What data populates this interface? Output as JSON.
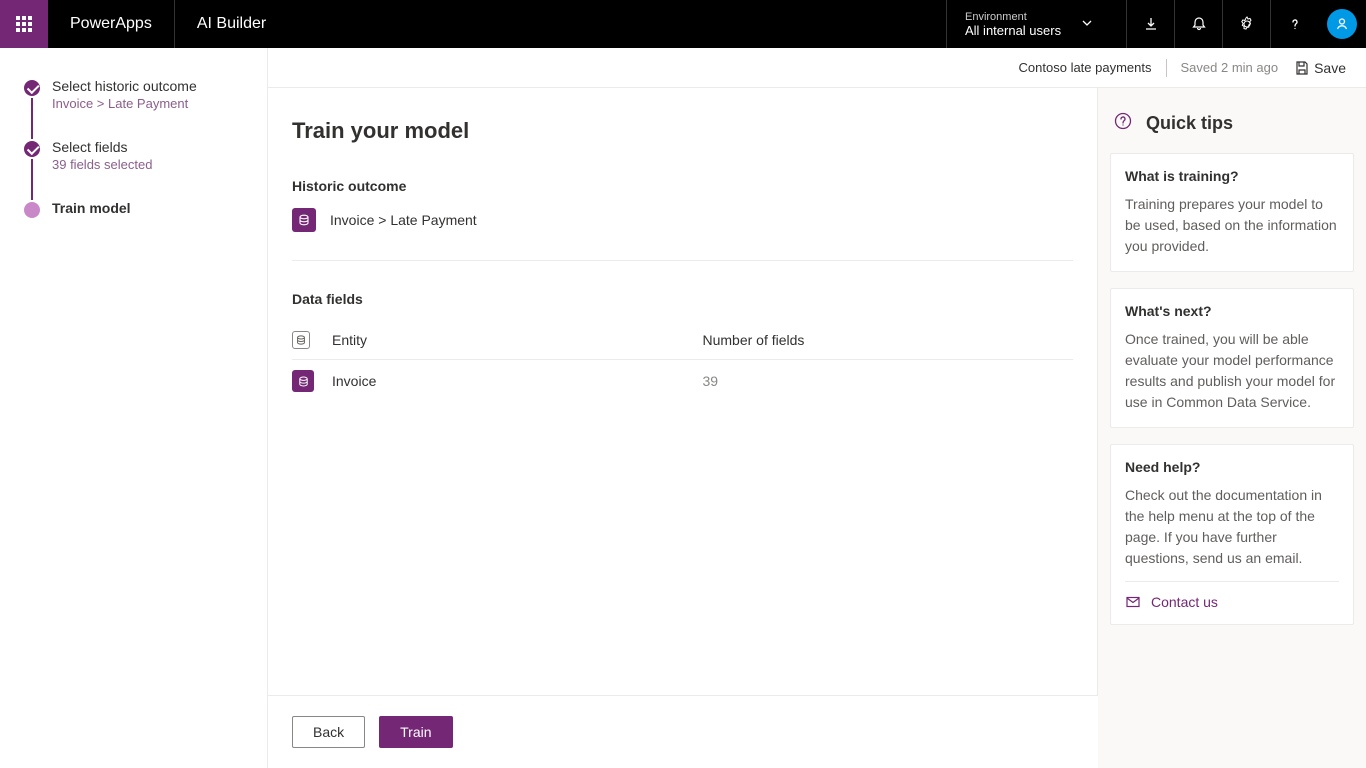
{
  "header": {
    "brand": "PowerApps",
    "subbrand": "AI Builder",
    "environment_label": "Environment",
    "environment_value": "All internal users"
  },
  "subbar": {
    "model_name": "Contoso late payments",
    "saved_text": "Saved 2 min ago",
    "save_label": "Save"
  },
  "steps": [
    {
      "title": "Select historic outcome",
      "sub": "Invoice > Late Payment",
      "state": "done"
    },
    {
      "title": "Select fields",
      "sub": "39 fields selected",
      "state": "done"
    },
    {
      "title": "Train model",
      "sub": "",
      "state": "current"
    }
  ],
  "main": {
    "title": "Train your model",
    "historic_label": "Historic outcome",
    "historic_value": "Invoice > Late Payment",
    "data_fields_label": "Data fields",
    "columns": {
      "entity": "Entity",
      "count": "Number of fields"
    },
    "rows": [
      {
        "entity": "Invoice",
        "count": "39"
      }
    ]
  },
  "footer": {
    "back": "Back",
    "train": "Train"
  },
  "tips": {
    "heading": "Quick tips",
    "cards": [
      {
        "title": "What is training?",
        "body": "Training prepares your model to be used, based on the information you provided."
      },
      {
        "title": "What's next?",
        "body": "Once trained, you will be able evaluate your model performance results and publish your model for use in Common Data Service."
      },
      {
        "title": "Need help?",
        "body": "Check out the documentation in the help menu at the top of the page. If you have further questions, send us an email.",
        "link": "Contact us"
      }
    ]
  }
}
